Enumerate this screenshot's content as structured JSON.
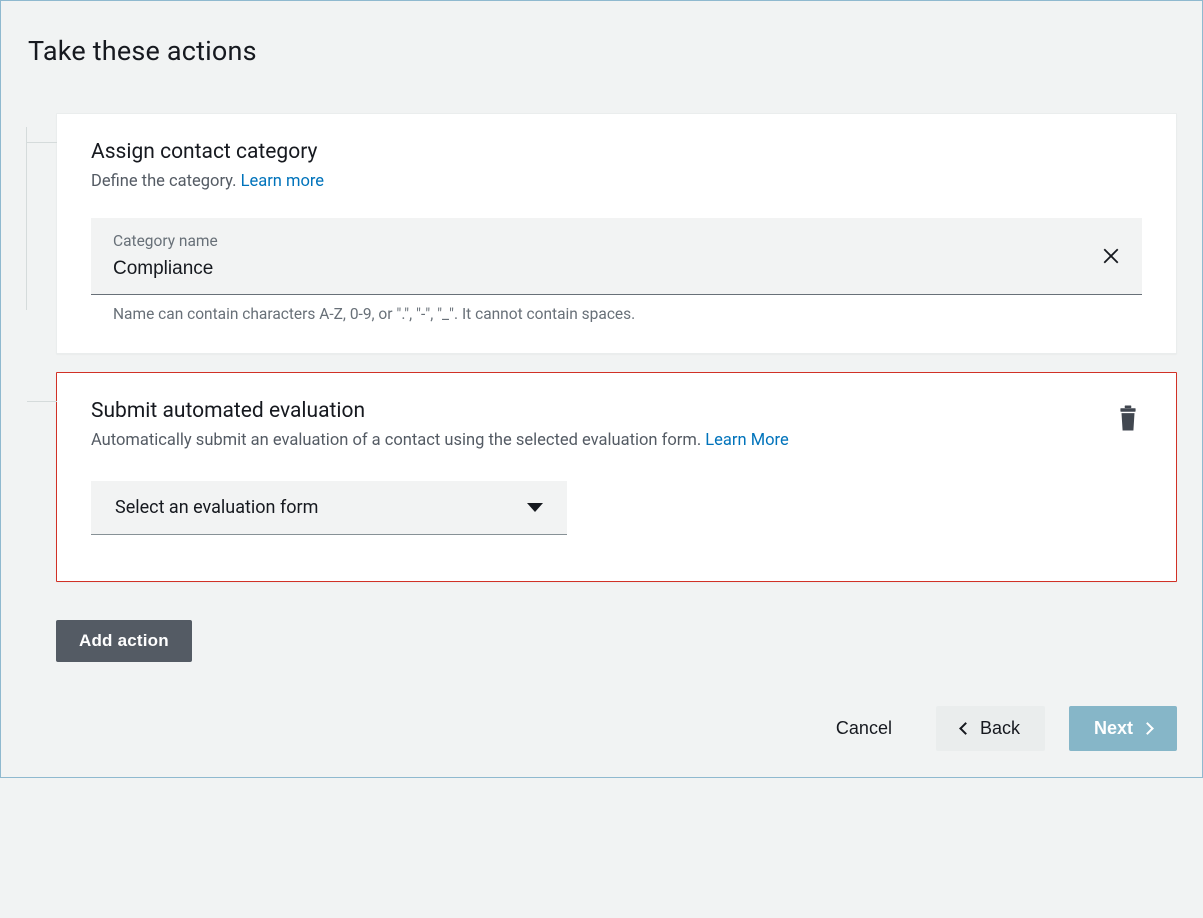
{
  "title": "Take these actions",
  "card1": {
    "title": "Assign contact category",
    "subtitle_prefix": "Define the category.",
    "learn_more": "Learn more",
    "field_label": "Category name",
    "field_value": "Compliance",
    "hint": "Name can contain characters A-Z, 0-9, or \".\", \"-\", \"_\". It cannot contain spaces."
  },
  "card2": {
    "title": "Submit automated evaluation",
    "subtitle_prefix": "Automatically submit an evaluation of a contact using the selected evaluation form.",
    "learn_more": "Learn More",
    "dropdown_label": "Select an evaluation form"
  },
  "buttons": {
    "add_action": "Add action",
    "cancel": "Cancel",
    "back": "Back",
    "next": "Next"
  }
}
